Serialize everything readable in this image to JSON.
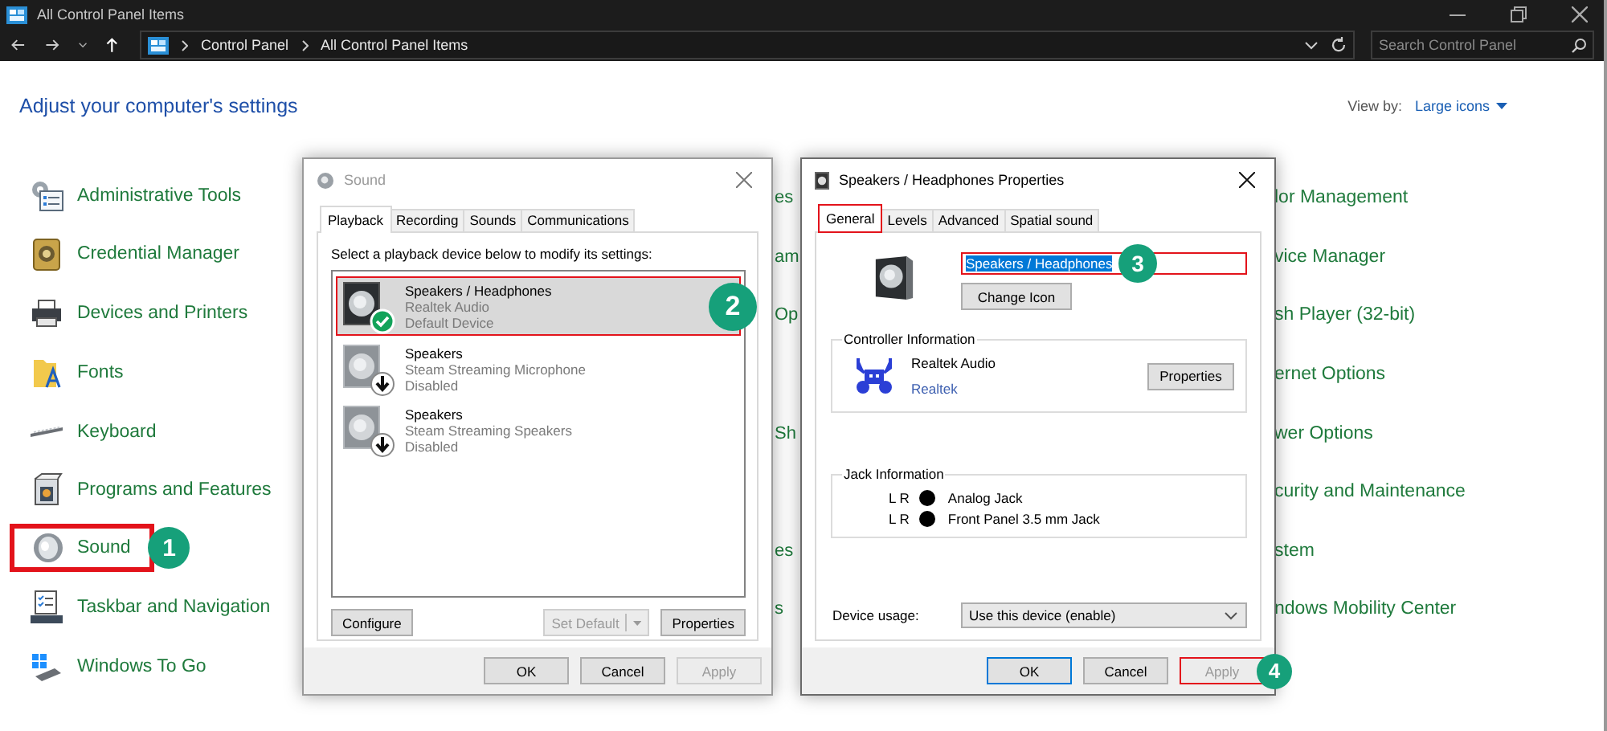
{
  "window": {
    "title": "All Control Panel Items"
  },
  "address_bar": {
    "breadcrumbs": [
      "Control Panel",
      "All Control Panel Items"
    ],
    "search": {
      "placeholder": "Search Control Panel"
    }
  },
  "header": {
    "heading": "Adjust your computer's settings",
    "view_by_label": "View by:",
    "view_by_value": "Large icons"
  },
  "rows": [
    {
      "left": {
        "label": "Administrative Tools",
        "highlighted": false
      },
      "middle": "es",
      "right": "lor Management"
    },
    {
      "left": {
        "label": "Credential Manager",
        "highlighted": false
      },
      "middle": "am",
      "right": "vice Manager"
    },
    {
      "left": {
        "label": "Devices and Printers",
        "highlighted": false
      },
      "middle": "Op",
      "right": "sh Player (32-bit)"
    },
    {
      "left": {
        "label": "Fonts",
        "highlighted": false
      },
      "right": "ernet Options"
    },
    {
      "left": {
        "label": "Keyboard",
        "highlighted": false
      },
      "middle": "Sh",
      "right": "wer Options"
    },
    {
      "left": {
        "label": "Programs and Features",
        "highlighted": false
      },
      "right": "curity and Maintenance"
    },
    {
      "left": {
        "label": "Sound",
        "highlighted": true,
        "callout": "1"
      },
      "middle": "es",
      "right": "stem"
    },
    {
      "left": {
        "label": "Taskbar and Navigation",
        "highlighted": false
      },
      "middle": "s",
      "right": "ndows Mobility Center"
    },
    {
      "left": {
        "label": "Windows To Go",
        "highlighted": false
      }
    }
  ],
  "sound_dialog": {
    "title": "Sound",
    "tabs": [
      {
        "label": "Playback",
        "selected": true
      },
      {
        "label": "Recording",
        "selected": false
      },
      {
        "label": "Sounds",
        "selected": false
      },
      {
        "label": "Communications",
        "selected": false
      }
    ],
    "instruction": "Select a playback device below to modify its settings:",
    "devices": [
      {
        "name": "Speakers / Headphones",
        "driver": "Realtek Audio",
        "status": "Default Device",
        "kind": "default",
        "selected": true,
        "highlighted": true,
        "callout": "2"
      },
      {
        "name": "Speakers",
        "driver": "Steam Streaming Microphone",
        "status": "Disabled",
        "kind": "disabled",
        "selected": false,
        "highlighted": false
      },
      {
        "name": "Speakers",
        "driver": "Steam Streaming Speakers",
        "status": "Disabled",
        "kind": "disabled",
        "selected": false,
        "highlighted": false
      }
    ],
    "configure": {
      "label": "Configure",
      "disabled": false
    },
    "set_default": {
      "label": "Set Default",
      "disabled": true
    },
    "properties": {
      "label": "Properties",
      "disabled": false
    },
    "footer": [
      {
        "label": "OK",
        "disabled": false
      },
      {
        "label": "Cancel",
        "disabled": false
      },
      {
        "label": "Apply",
        "disabled": true
      }
    ]
  },
  "properties_dialog": {
    "title": "Speakers / Headphones Properties",
    "tabs": [
      {
        "label": "General",
        "selected": true,
        "highlighted": true
      },
      {
        "label": "Levels",
        "selected": false,
        "highlighted": false
      },
      {
        "label": "Advanced",
        "selected": false,
        "highlighted": false
      },
      {
        "label": "Spatial sound",
        "selected": false,
        "highlighted": false
      }
    ],
    "name_field": {
      "value": "Speakers / Headphones",
      "text_selected": true,
      "highlighted": true,
      "callout": "3"
    },
    "change_icon": "Change Icon",
    "controller": {
      "title": "Controller Information",
      "name": "Realtek Audio",
      "link": "Realtek",
      "button": "Properties"
    },
    "jacks": {
      "title": "Jack Information",
      "items": [
        {
          "channels": "L R",
          "name": "Analog Jack"
        },
        {
          "channels": "L R",
          "name": "Front Panel 3.5 mm Jack"
        }
      ]
    },
    "device_usage": {
      "label": "Device usage:",
      "value": "Use this device (enable)"
    },
    "footer": [
      {
        "label": "OK",
        "disabled": false,
        "default": true,
        "highlighted": false
      },
      {
        "label": "Cancel",
        "disabled": false,
        "default": false,
        "highlighted": false
      },
      {
        "label": "Apply",
        "disabled": true,
        "default": false,
        "highlighted": true,
        "callout": "4"
      }
    ]
  }
}
